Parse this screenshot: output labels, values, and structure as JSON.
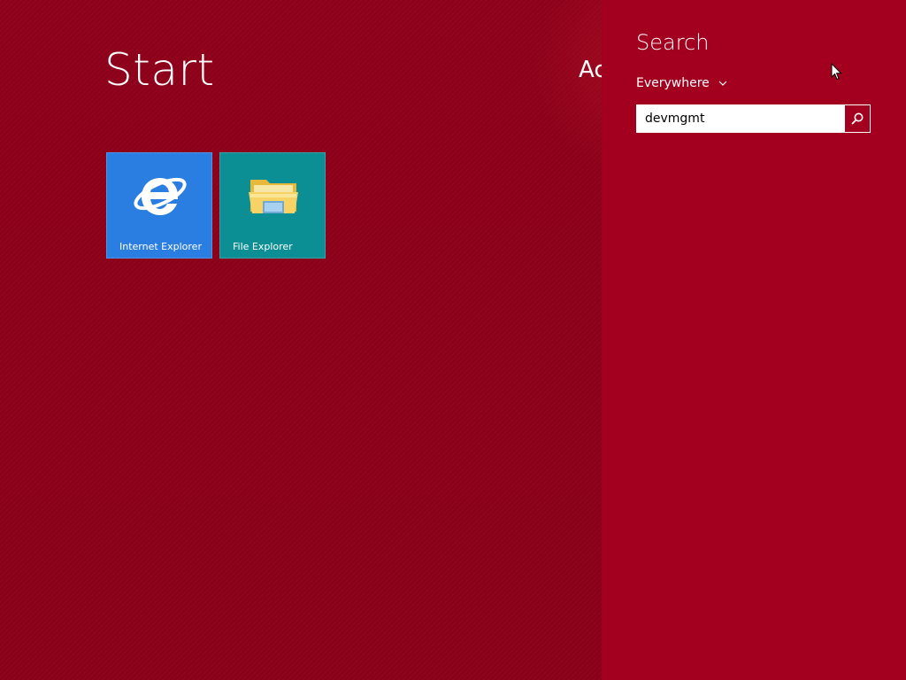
{
  "start": {
    "title": "Start",
    "account_partial": "Ac"
  },
  "tiles": [
    {
      "label": "Internet Explorer",
      "icon": "internet-explorer-icon",
      "color": "#2a7de1"
    },
    {
      "label": "File Explorer",
      "icon": "folder-icon",
      "color": "#0c8f94"
    }
  ],
  "search": {
    "heading": "Search",
    "scope": "Everywhere",
    "query": "devmgmt",
    "icon": "search-icon"
  },
  "colors": {
    "start_background": "#8e0018",
    "charm_background": "#a3001f",
    "text": "#ffffff"
  }
}
